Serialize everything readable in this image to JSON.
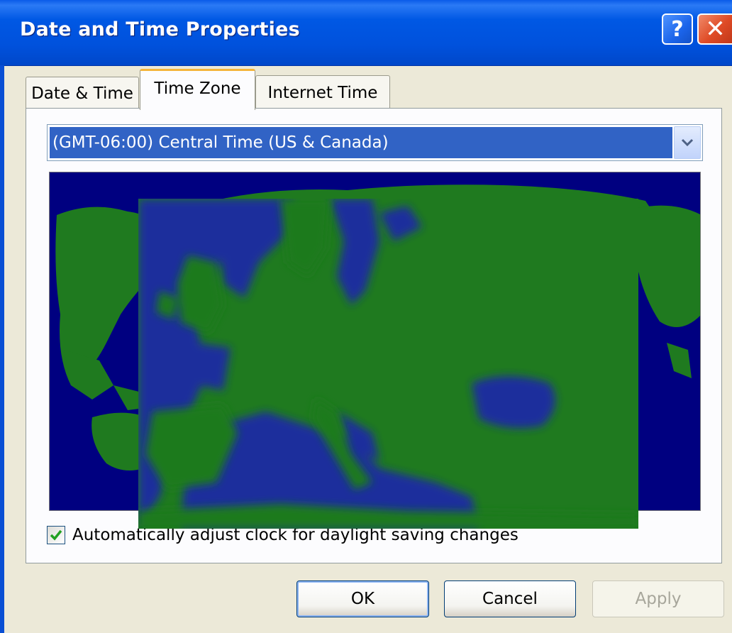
{
  "window": {
    "title": "Date and Time Properties",
    "help_glyph": "?",
    "close_glyph": "✕"
  },
  "tabs": [
    {
      "label": "Date & Time",
      "active": false
    },
    {
      "label": "Time Zone",
      "active": true
    },
    {
      "label": "Internet Time",
      "active": false
    }
  ],
  "timezone": {
    "selected": "(GMT-06:00) Central Time (US & Canada)"
  },
  "map": {
    "ocean_color": "#000080",
    "land_color": "#1f7a1f"
  },
  "daylight_saving": {
    "label": "Automatically adjust clock for daylight saving changes",
    "checked": true
  },
  "buttons": {
    "ok": "OK",
    "cancel": "Cancel",
    "apply": "Apply",
    "apply_enabled": false
  },
  "colors": {
    "titlebar": "#0054e3",
    "selection": "#3163c5",
    "active_tab_accent": "#f5b53a"
  }
}
